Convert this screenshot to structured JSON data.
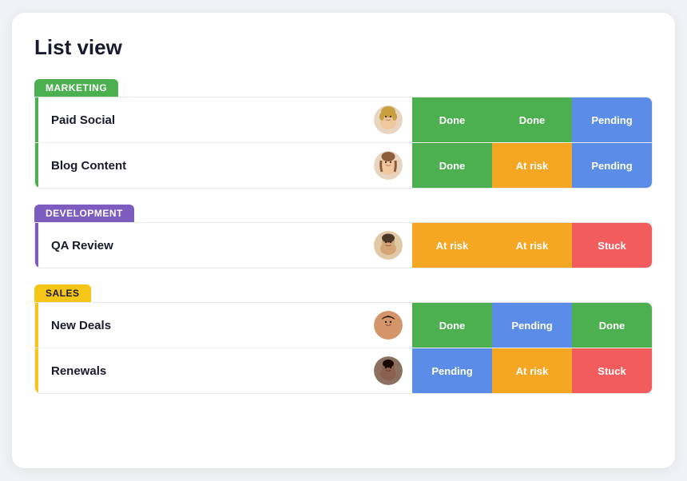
{
  "title": "List view",
  "groups": [
    {
      "id": "marketing",
      "label": "MARKETING",
      "header_class": "group-header-marketing",
      "accent_class": "accent-marketing",
      "rows": [
        {
          "id": "paid-social",
          "name": "Paid Social",
          "avatar_color": "#f0c8a0",
          "avatar_hair": "#c8a040",
          "avatar_type": "female1",
          "statuses": [
            {
              "label": "Done",
              "class": "status-done"
            },
            {
              "label": "Done",
              "class": "status-done"
            },
            {
              "label": "Pending",
              "class": "status-pending"
            }
          ]
        },
        {
          "id": "blog-content",
          "name": "Blog Content",
          "avatar_color": "#f0c8a0",
          "avatar_hair": "#8b5e3c",
          "avatar_type": "female2",
          "statuses": [
            {
              "label": "Done",
              "class": "status-done"
            },
            {
              "label": "At risk",
              "class": "status-at-risk"
            },
            {
              "label": "Pending",
              "class": "status-pending"
            }
          ]
        }
      ]
    },
    {
      "id": "development",
      "label": "DEVELOPMENT",
      "header_class": "group-header-development",
      "accent_class": "accent-development",
      "rows": [
        {
          "id": "qa-review",
          "name": "QA Review",
          "avatar_color": "#d4a574",
          "avatar_hair": "#4a3728",
          "avatar_type": "male1",
          "statuses": [
            {
              "label": "At risk",
              "class": "status-at-risk"
            },
            {
              "label": "At risk",
              "class": "status-at-risk"
            },
            {
              "label": "Stuck",
              "class": "status-stuck"
            }
          ]
        }
      ]
    },
    {
      "id": "sales",
      "label": "SALES",
      "header_class": "group-header-sales",
      "accent_class": "accent-sales",
      "rows": [
        {
          "id": "new-deals",
          "name": "New Deals",
          "avatar_color": "#d4956a",
          "avatar_hair": "#2c1a0e",
          "avatar_type": "male2",
          "statuses": [
            {
              "label": "Done",
              "class": "status-done"
            },
            {
              "label": "Pending",
              "class": "status-pending"
            },
            {
              "label": "Done",
              "class": "status-done"
            }
          ]
        },
        {
          "id": "renewals",
          "name": "Renewals",
          "avatar_color": "#8b6050",
          "avatar_hair": "#1a0a00",
          "avatar_type": "male3",
          "statuses": [
            {
              "label": "Pending",
              "class": "status-pending"
            },
            {
              "label": "At risk",
              "class": "status-at-risk"
            },
            {
              "label": "Stuck",
              "class": "status-stuck"
            }
          ]
        }
      ]
    }
  ]
}
